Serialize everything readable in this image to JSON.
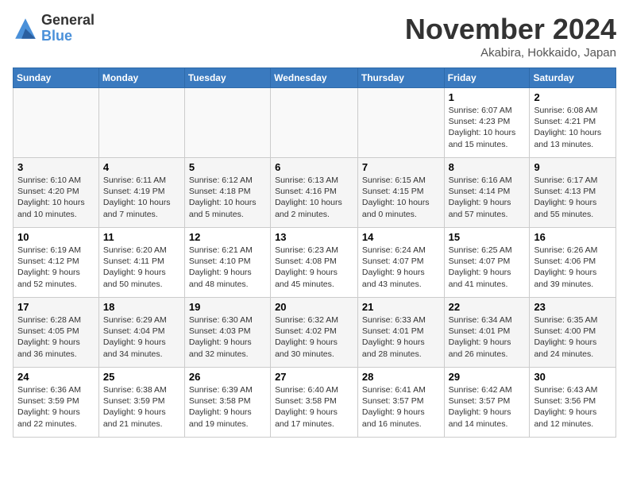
{
  "logo": {
    "general": "General",
    "blue": "Blue"
  },
  "title": "November 2024",
  "location": "Akabira, Hokkaido, Japan",
  "weekdays": [
    "Sunday",
    "Monday",
    "Tuesday",
    "Wednesday",
    "Thursday",
    "Friday",
    "Saturday"
  ],
  "weeks": [
    [
      {
        "day": "",
        "info": ""
      },
      {
        "day": "",
        "info": ""
      },
      {
        "day": "",
        "info": ""
      },
      {
        "day": "",
        "info": ""
      },
      {
        "day": "",
        "info": ""
      },
      {
        "day": "1",
        "info": "Sunrise: 6:07 AM\nSunset: 4:23 PM\nDaylight: 10 hours\nand 15 minutes."
      },
      {
        "day": "2",
        "info": "Sunrise: 6:08 AM\nSunset: 4:21 PM\nDaylight: 10 hours\nand 13 minutes."
      }
    ],
    [
      {
        "day": "3",
        "info": "Sunrise: 6:10 AM\nSunset: 4:20 PM\nDaylight: 10 hours\nand 10 minutes."
      },
      {
        "day": "4",
        "info": "Sunrise: 6:11 AM\nSunset: 4:19 PM\nDaylight: 10 hours\nand 7 minutes."
      },
      {
        "day": "5",
        "info": "Sunrise: 6:12 AM\nSunset: 4:18 PM\nDaylight: 10 hours\nand 5 minutes."
      },
      {
        "day": "6",
        "info": "Sunrise: 6:13 AM\nSunset: 4:16 PM\nDaylight: 10 hours\nand 2 minutes."
      },
      {
        "day": "7",
        "info": "Sunrise: 6:15 AM\nSunset: 4:15 PM\nDaylight: 10 hours\nand 0 minutes."
      },
      {
        "day": "8",
        "info": "Sunrise: 6:16 AM\nSunset: 4:14 PM\nDaylight: 9 hours\nand 57 minutes."
      },
      {
        "day": "9",
        "info": "Sunrise: 6:17 AM\nSunset: 4:13 PM\nDaylight: 9 hours\nand 55 minutes."
      }
    ],
    [
      {
        "day": "10",
        "info": "Sunrise: 6:19 AM\nSunset: 4:12 PM\nDaylight: 9 hours\nand 52 minutes."
      },
      {
        "day": "11",
        "info": "Sunrise: 6:20 AM\nSunset: 4:11 PM\nDaylight: 9 hours\nand 50 minutes."
      },
      {
        "day": "12",
        "info": "Sunrise: 6:21 AM\nSunset: 4:10 PM\nDaylight: 9 hours\nand 48 minutes."
      },
      {
        "day": "13",
        "info": "Sunrise: 6:23 AM\nSunset: 4:08 PM\nDaylight: 9 hours\nand 45 minutes."
      },
      {
        "day": "14",
        "info": "Sunrise: 6:24 AM\nSunset: 4:07 PM\nDaylight: 9 hours\nand 43 minutes."
      },
      {
        "day": "15",
        "info": "Sunrise: 6:25 AM\nSunset: 4:07 PM\nDaylight: 9 hours\nand 41 minutes."
      },
      {
        "day": "16",
        "info": "Sunrise: 6:26 AM\nSunset: 4:06 PM\nDaylight: 9 hours\nand 39 minutes."
      }
    ],
    [
      {
        "day": "17",
        "info": "Sunrise: 6:28 AM\nSunset: 4:05 PM\nDaylight: 9 hours\nand 36 minutes."
      },
      {
        "day": "18",
        "info": "Sunrise: 6:29 AM\nSunset: 4:04 PM\nDaylight: 9 hours\nand 34 minutes."
      },
      {
        "day": "19",
        "info": "Sunrise: 6:30 AM\nSunset: 4:03 PM\nDaylight: 9 hours\nand 32 minutes."
      },
      {
        "day": "20",
        "info": "Sunrise: 6:32 AM\nSunset: 4:02 PM\nDaylight: 9 hours\nand 30 minutes."
      },
      {
        "day": "21",
        "info": "Sunrise: 6:33 AM\nSunset: 4:01 PM\nDaylight: 9 hours\nand 28 minutes."
      },
      {
        "day": "22",
        "info": "Sunrise: 6:34 AM\nSunset: 4:01 PM\nDaylight: 9 hours\nand 26 minutes."
      },
      {
        "day": "23",
        "info": "Sunrise: 6:35 AM\nSunset: 4:00 PM\nDaylight: 9 hours\nand 24 minutes."
      }
    ],
    [
      {
        "day": "24",
        "info": "Sunrise: 6:36 AM\nSunset: 3:59 PM\nDaylight: 9 hours\nand 22 minutes."
      },
      {
        "day": "25",
        "info": "Sunrise: 6:38 AM\nSunset: 3:59 PM\nDaylight: 9 hours\nand 21 minutes."
      },
      {
        "day": "26",
        "info": "Sunrise: 6:39 AM\nSunset: 3:58 PM\nDaylight: 9 hours\nand 19 minutes."
      },
      {
        "day": "27",
        "info": "Sunrise: 6:40 AM\nSunset: 3:58 PM\nDaylight: 9 hours\nand 17 minutes."
      },
      {
        "day": "28",
        "info": "Sunrise: 6:41 AM\nSunset: 3:57 PM\nDaylight: 9 hours\nand 16 minutes."
      },
      {
        "day": "29",
        "info": "Sunrise: 6:42 AM\nSunset: 3:57 PM\nDaylight: 9 hours\nand 14 minutes."
      },
      {
        "day": "30",
        "info": "Sunrise: 6:43 AM\nSunset: 3:56 PM\nDaylight: 9 hours\nand 12 minutes."
      }
    ]
  ]
}
